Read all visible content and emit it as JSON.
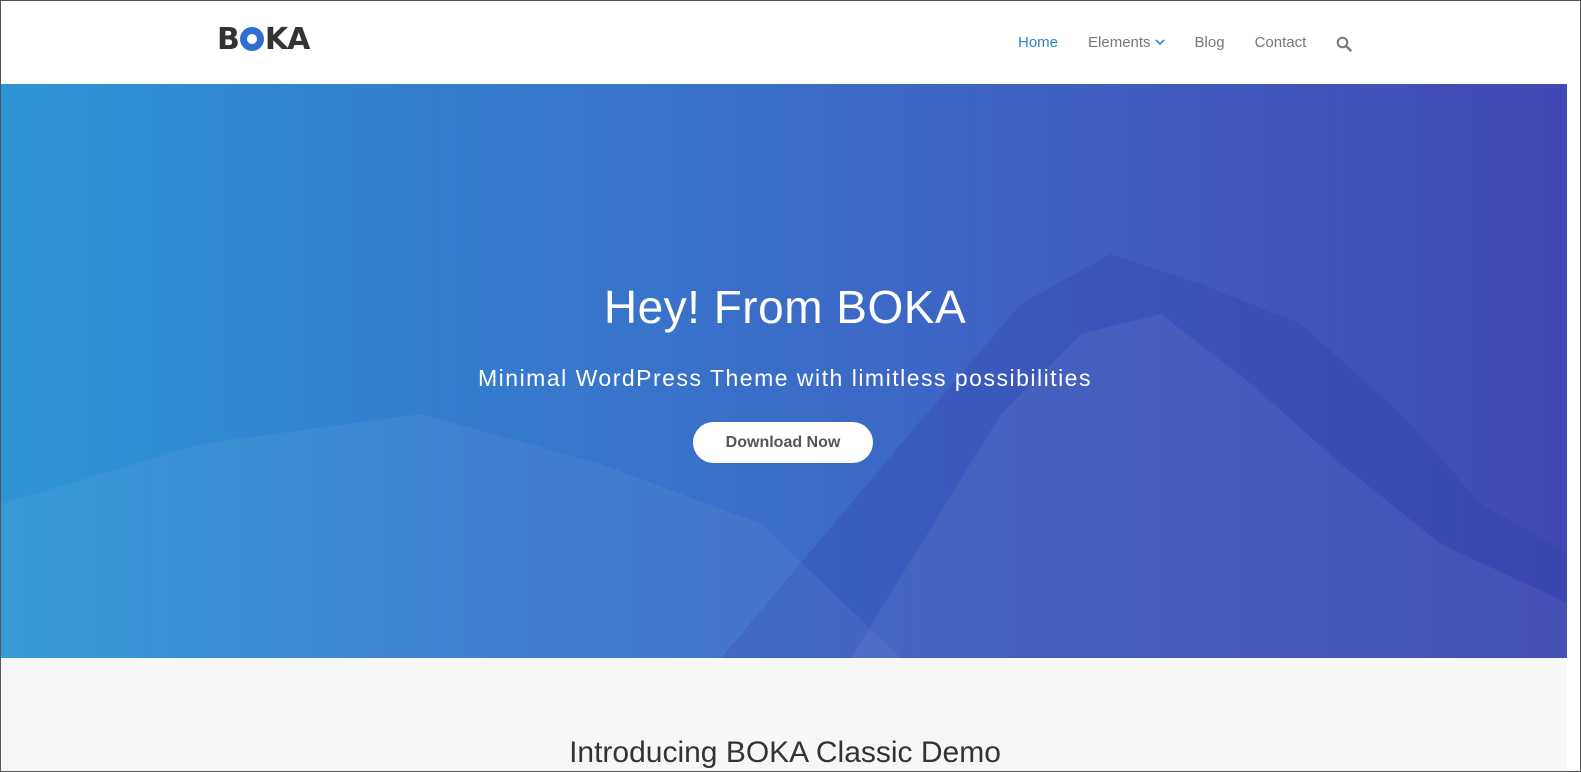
{
  "header": {
    "logo_text": {
      "b": "B",
      "k": "K",
      "a": "A"
    },
    "nav": [
      {
        "label": "Home"
      },
      {
        "label": "Elements"
      },
      {
        "label": "Blog"
      },
      {
        "label": "Contact"
      }
    ],
    "active_color": "#2c86c9"
  },
  "hero": {
    "title": "Hey! From BOKA",
    "subtitle": "Minimal WordPress Theme with limitless possibilities",
    "button_label": "Download Now",
    "gradient_start": "#2e95d4",
    "gradient_end": "#4248b5"
  },
  "intro": {
    "title": "Introducing BOKA Classic Demo"
  },
  "icons": {
    "search": "search-icon",
    "chevron": "chevron-down-icon",
    "logo": "logo-o-mark-icon"
  }
}
